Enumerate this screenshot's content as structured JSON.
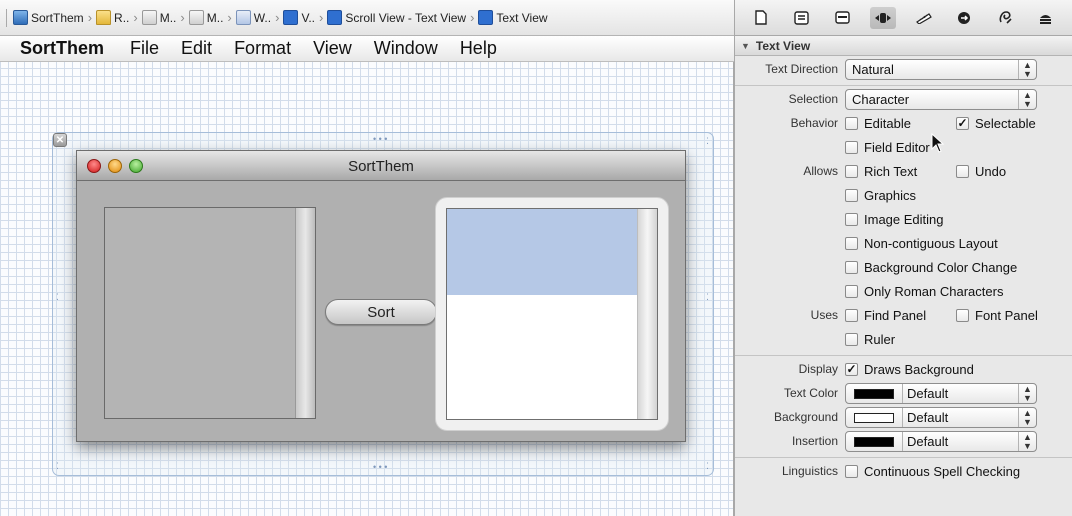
{
  "jumpbar": {
    "crumbs": [
      {
        "label": "SortThem",
        "icon": "project-icon"
      },
      {
        "label": "R..",
        "icon": "folder-icon"
      },
      {
        "label": "M..",
        "icon": "app-icon"
      },
      {
        "label": "M..",
        "icon": "app-icon"
      },
      {
        "label": "W..",
        "icon": "xib-icon"
      },
      {
        "label": "V..",
        "icon": "view-icon"
      },
      {
        "label": "Scroll View - Text View",
        "icon": "view-icon"
      },
      {
        "label": "Text View",
        "icon": "view-icon"
      }
    ]
  },
  "inspector_toolbar": {
    "icons": [
      "file-inspector-icon",
      "quick-help-icon",
      "identity-inspector-icon",
      "attributes-inspector-icon",
      "size-inspector-icon",
      "connections-inspector-icon",
      "bindings-inspector-icon",
      "view-effects-icon"
    ],
    "active_index": 3
  },
  "menubar": {
    "app": "SortThem",
    "items": [
      "File",
      "Edit",
      "Format",
      "View",
      "Window",
      "Help"
    ]
  },
  "window": {
    "title": "SortThem",
    "sort_button": "Sort"
  },
  "inspector": {
    "header": "Text View",
    "text_direction": {
      "label": "Text Direction",
      "value": "Natural"
    },
    "selection": {
      "label": "Selection",
      "value": "Character"
    },
    "behavior_label": "Behavior",
    "editable": {
      "label": "Editable",
      "checked": false
    },
    "selectable": {
      "label": "Selectable",
      "checked": true
    },
    "field_editor": {
      "label": "Field Editor",
      "checked": false
    },
    "allows_label": "Allows",
    "rich_text": {
      "label": "Rich Text",
      "checked": false
    },
    "undo": {
      "label": "Undo",
      "checked": false
    },
    "graphics": {
      "label": "Graphics",
      "checked": false
    },
    "image_editing": {
      "label": "Image Editing",
      "checked": false
    },
    "non_contiguous": {
      "label": "Non-contiguous Layout",
      "checked": false
    },
    "bg_color_change": {
      "label": "Background Color Change",
      "checked": false
    },
    "only_roman": {
      "label": "Only Roman Characters",
      "checked": false
    },
    "uses_label": "Uses",
    "find_panel": {
      "label": "Find Panel",
      "checked": false
    },
    "font_panel": {
      "label": "Font Panel",
      "checked": false
    },
    "ruler": {
      "label": "Ruler",
      "checked": false
    },
    "display_label": "Display",
    "draws_background": {
      "label": "Draws Background",
      "checked": true
    },
    "text_color": {
      "label": "Text Color",
      "value": "Default",
      "swatch": "#000000"
    },
    "background": {
      "label": "Background",
      "value": "Default",
      "swatch": "#ffffff"
    },
    "insertion": {
      "label": "Insertion",
      "value": "Default",
      "swatch": "#000000"
    },
    "linguistics_label": "Linguistics",
    "continuous_spell": {
      "label": "Continuous Spell Checking",
      "checked": false
    }
  }
}
